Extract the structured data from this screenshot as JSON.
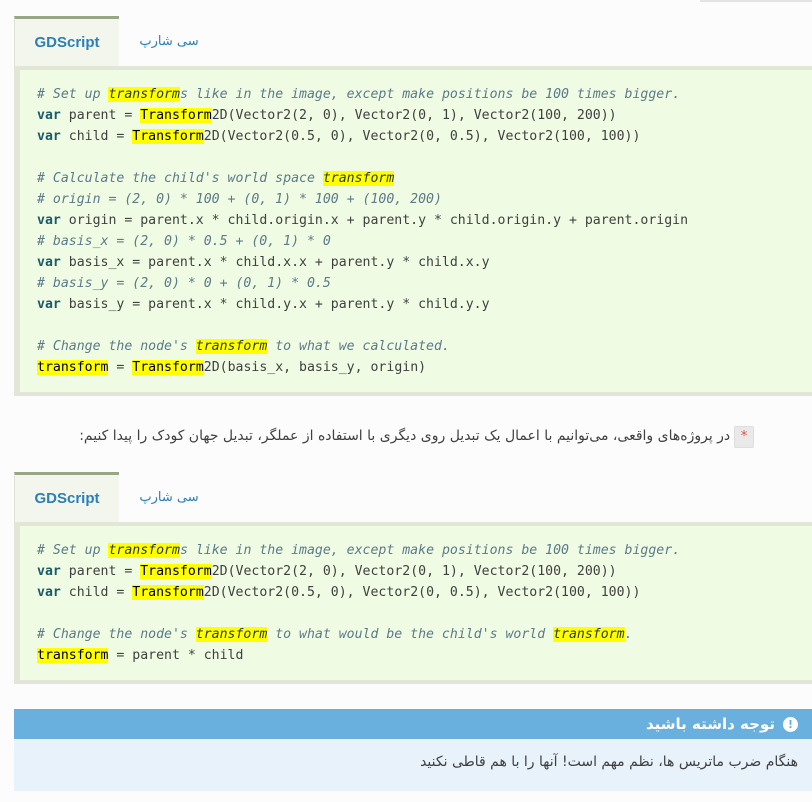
{
  "block1": {
    "tab_active": "GDScript",
    "tab_inactive": "سی شارپ"
  },
  "block2": {
    "tab_active": "GDScript",
    "tab_inactive": "سی شارپ"
  },
  "paragraph": {
    "text": "در پروژه‌های واقعی، می‌توانیم با اعمال یک تبدیل روی دیگری با استفاده از عملگر، تبدیل جهان کودک را پیدا کنیم:",
    "operator": "*"
  },
  "note": {
    "title": "توجه داشته باشید",
    "body": "هنگام ضرب ماتریس ها، نظم مهم است! آنها را با هم قاطی نکنید"
  },
  "colors": {
    "highlight": "#ffff00",
    "link": "#2980b9",
    "note_header": "#6ab0de",
    "code_bg": "#f0fbe3"
  },
  "icons": {
    "note": "exclamation-circle-icon"
  }
}
